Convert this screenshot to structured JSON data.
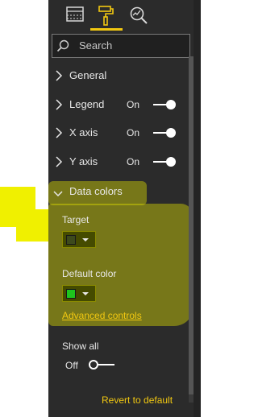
{
  "search": {
    "placeholder": "Search"
  },
  "toolbar": {
    "icons": [
      "fields-icon",
      "format-paint-roller-icon",
      "analytics-magnifier-icon"
    ]
  },
  "sections": [
    {
      "label": "General",
      "expanded": false
    },
    {
      "label": "Legend",
      "expanded": false,
      "toggle": "On"
    },
    {
      "label": "X axis",
      "expanded": false,
      "toggle": "On"
    },
    {
      "label": "Y axis",
      "expanded": false,
      "toggle": "On"
    },
    {
      "label": "Data colors",
      "expanded": true
    }
  ],
  "data_colors": {
    "target_label": "Target",
    "target_color": "#3d4a1c",
    "default_label": "Default color",
    "default_color": "#1ec51e",
    "advanced_link": "Advanced controls"
  },
  "show_all": {
    "label": "Show all",
    "state": "Off"
  },
  "revert": "Revert to default",
  "colors": {
    "accent": "#f2c811",
    "panel_bg": "#2b2b2b",
    "highlight": "#f0f000"
  }
}
